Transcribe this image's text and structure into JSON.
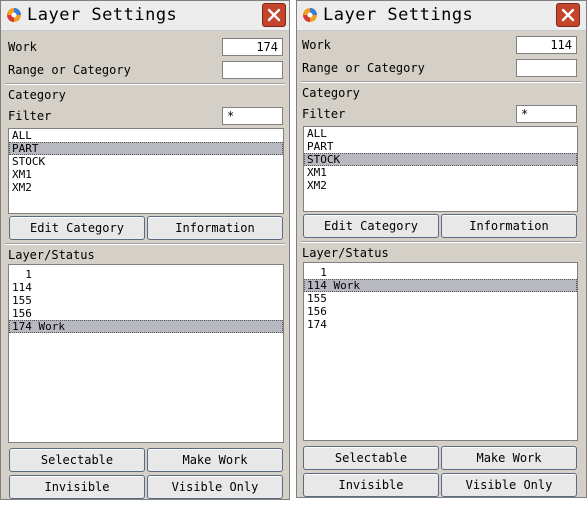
{
  "dialogs": [
    {
      "title": "Layer Settings",
      "work_label": "Work",
      "work_value": "174",
      "range_label": "Range or Category",
      "range_value": "",
      "category_label": "Category",
      "filter_label": "Filter",
      "filter_value": "*",
      "categories": [
        "ALL",
        "PART",
        "STOCK",
        "XM1",
        "XM2"
      ],
      "selected_category": "PART",
      "edit_category_label": "Edit Category",
      "information_label": "Information",
      "layer_status_label": "Layer/Status",
      "layers": [
        "  1",
        "114",
        "155",
        "156",
        "174 Work"
      ],
      "selected_layer": "174 Work",
      "selectable_label": "Selectable",
      "make_work_label": "Make Work",
      "invisible_label": "Invisible",
      "visible_only_label": "Visible Only"
    },
    {
      "title": "Layer Settings",
      "work_label": "Work",
      "work_value": "114",
      "range_label": "Range or Category",
      "range_value": "",
      "category_label": "Category",
      "filter_label": "Filter",
      "filter_value": "*",
      "categories": [
        "ALL",
        "PART",
        "STOCK",
        "XM1",
        "XM2"
      ],
      "selected_category": "STOCK",
      "edit_category_label": "Edit Category",
      "information_label": "Information",
      "layer_status_label": "Layer/Status",
      "layers": [
        "  1",
        "114 Work",
        "155",
        "156",
        "174"
      ],
      "selected_layer": "114 Work",
      "selectable_label": "Selectable",
      "make_work_label": "Make Work",
      "invisible_label": "Invisible",
      "visible_only_label": "Visible Only"
    }
  ]
}
